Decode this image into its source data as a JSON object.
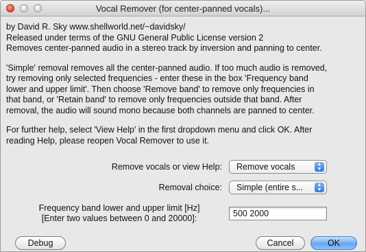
{
  "window": {
    "title": "Vocal Remover (for center-panned vocals)..."
  },
  "description": {
    "paragraph1": [
      "by David R. Sky www.shellworld.net/~davidsky/",
      "Released under terms of the GNU General Public License version 2",
      "Removes center-panned audio in a stereo track by inversion and panning to center."
    ],
    "paragraph2": [
      "'Simple' removal removes all the center-panned audio. If too much audio is removed,",
      "try removing only selected frequencies - enter these in the box 'Frequency band",
      "lower and upper limit'. Then choose 'Remove band' to remove only frequencies in",
      "that band, or 'Retain band' to remove only frequencies outside that band. After",
      "removal, the audio will sound mono because both channels are panned to center."
    ],
    "paragraph3": [
      "For further help, select 'View Help' in the first dropdown menu and click OK. After",
      "reading Help, please reopen Vocal Remover to use it."
    ]
  },
  "controls": {
    "action": {
      "label": "Remove vocals or view Help:",
      "value": "Remove vocals"
    },
    "choice": {
      "label": "Removal choice:",
      "value": "Simple (entire s..."
    },
    "band": {
      "label_line1": "Frequency band lower and upper limit [Hz]",
      "label_line2": "[Enter two values between 0 and 20000]:",
      "value": "500 2000"
    }
  },
  "buttons": {
    "debug": "Debug",
    "cancel": "Cancel",
    "ok": "OK"
  }
}
